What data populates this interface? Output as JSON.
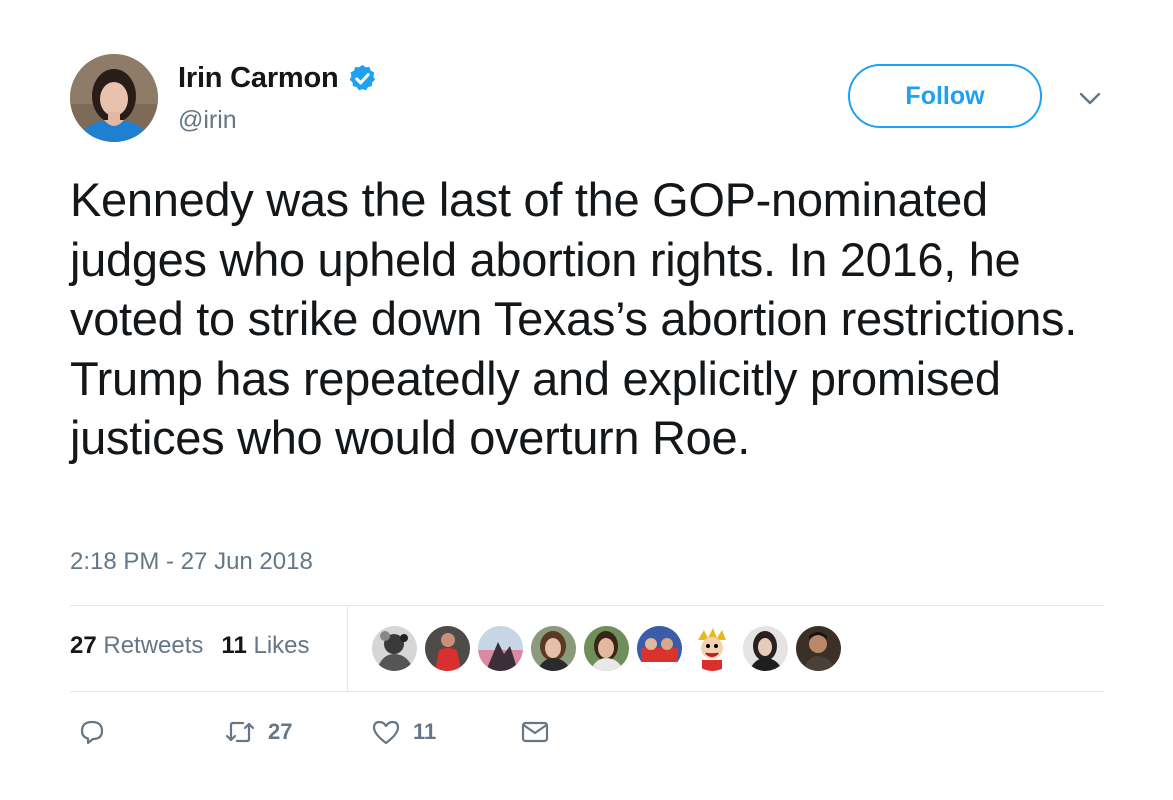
{
  "user": {
    "display_name": "Irin Carmon",
    "handle": "@irin",
    "verified": true
  },
  "follow_button": {
    "label": "Follow"
  },
  "tweet": {
    "text": "Kennedy was the last of the GOP-nominated judges who upheld abortion rights. In 2016, he voted to strike down Texas’s abortion restrictions. Trump has repeatedly and explicitly promised justices who would overturn Roe.",
    "timestamp": "2:18 PM - 27 Jun 2018"
  },
  "stats": {
    "retweets_count": "27",
    "retweets_label": "Retweets",
    "likes_count": "11",
    "likes_label": "Likes"
  },
  "actions": {
    "reply_icon": "reply-icon",
    "retweet_icon": "retweet-icon",
    "retweet_count": "27",
    "like_icon": "heart-icon",
    "like_count": "11",
    "dm_icon": "envelope-icon"
  },
  "colors": {
    "accent": "#1da1f2",
    "text": "#14171a",
    "secondary": "#657786",
    "divider": "#e1e8ed"
  }
}
